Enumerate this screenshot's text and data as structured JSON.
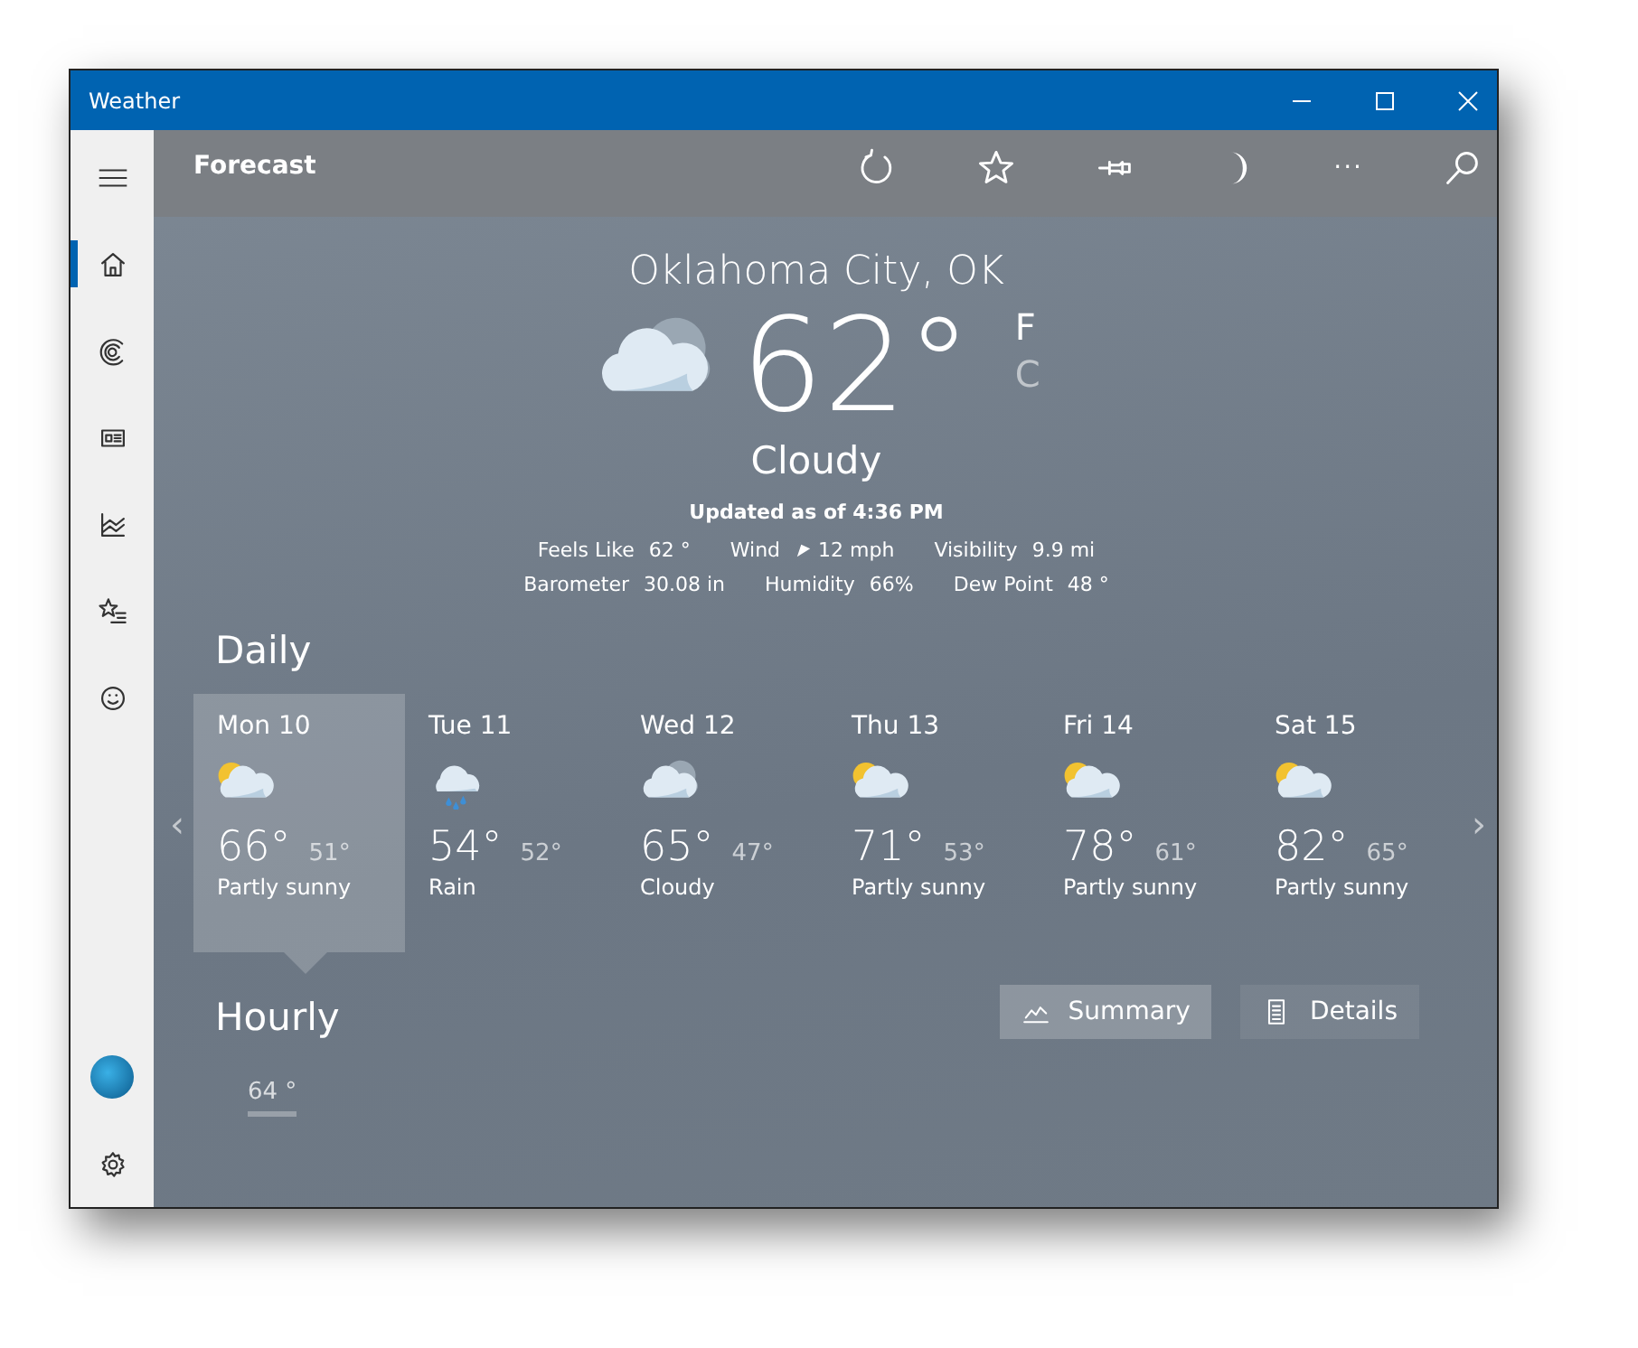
{
  "window": {
    "title": "Weather"
  },
  "toolbar": {
    "title": "Forecast",
    "actions": [
      {
        "kind": "refresh"
      },
      {
        "kind": "favorite"
      },
      {
        "kind": "pin"
      },
      {
        "kind": "theme"
      },
      {
        "kind": "more",
        "label": "···"
      },
      {
        "kind": "search"
      }
    ]
  },
  "sidebar": {
    "items": [
      {
        "kind": "home",
        "selected": true
      },
      {
        "kind": "maps",
        "selected": false
      },
      {
        "kind": "news",
        "selected": false
      },
      {
        "kind": "historical",
        "selected": false
      },
      {
        "kind": "places",
        "selected": false
      },
      {
        "kind": "feedback",
        "selected": false
      }
    ],
    "bottom": [
      {
        "kind": "account"
      },
      {
        "kind": "settings"
      }
    ]
  },
  "current": {
    "city": "Oklahoma City, OK",
    "kind": "cloudy",
    "temp": "62",
    "degree": "°",
    "units": [
      {
        "label": "F",
        "selected": true
      },
      {
        "label": "C",
        "selected": false
      }
    ],
    "condition": "Cloudy",
    "updated": "Updated as of 4:36 PM",
    "details": [
      [
        {
          "label": "Feels Like",
          "value": "62 °",
          "kind": "plain"
        },
        {
          "label": "Wind",
          "value": "12 mph",
          "kind": "wind"
        },
        {
          "label": "Visibility",
          "value": "9.9 mi",
          "kind": "plain"
        }
      ],
      [
        {
          "label": "Barometer",
          "value": "30.08 in",
          "kind": "plain"
        },
        {
          "label": "Humidity",
          "value": "66%",
          "kind": "plain"
        },
        {
          "label": "Dew Point",
          "value": "48 °",
          "kind": "plain"
        }
      ]
    ]
  },
  "daily": {
    "heading": "Daily",
    "prev": "‹",
    "next": "›",
    "days": [
      {
        "day": "Mon 10",
        "kind": "partly-sunny",
        "high": "66°",
        "low": "51°",
        "condition": "Partly sunny",
        "selected": true
      },
      {
        "day": "Tue 11",
        "kind": "rain",
        "high": "54°",
        "low": "52°",
        "condition": "Rain",
        "selected": false
      },
      {
        "day": "Wed 12",
        "kind": "cloudy",
        "high": "65°",
        "low": "47°",
        "condition": "Cloudy",
        "selected": false
      },
      {
        "day": "Thu 13",
        "kind": "partly-sunny",
        "high": "71°",
        "low": "53°",
        "condition": "Partly sunny",
        "selected": false
      },
      {
        "day": "Fri 14",
        "kind": "partly-sunny",
        "high": "78°",
        "low": "61°",
        "condition": "Partly sunny",
        "selected": false
      },
      {
        "day": "Sat 15",
        "kind": "partly-sunny",
        "high": "82°",
        "low": "65°",
        "condition": "Partly sunny",
        "selected": false
      }
    ]
  },
  "hourly": {
    "heading": "Hourly",
    "tabs": [
      {
        "label": "Summary",
        "kind": "chart",
        "selected": true
      },
      {
        "label": "Details",
        "kind": "list",
        "selected": false
      }
    ],
    "temps": [
      "64 °"
    ]
  }
}
